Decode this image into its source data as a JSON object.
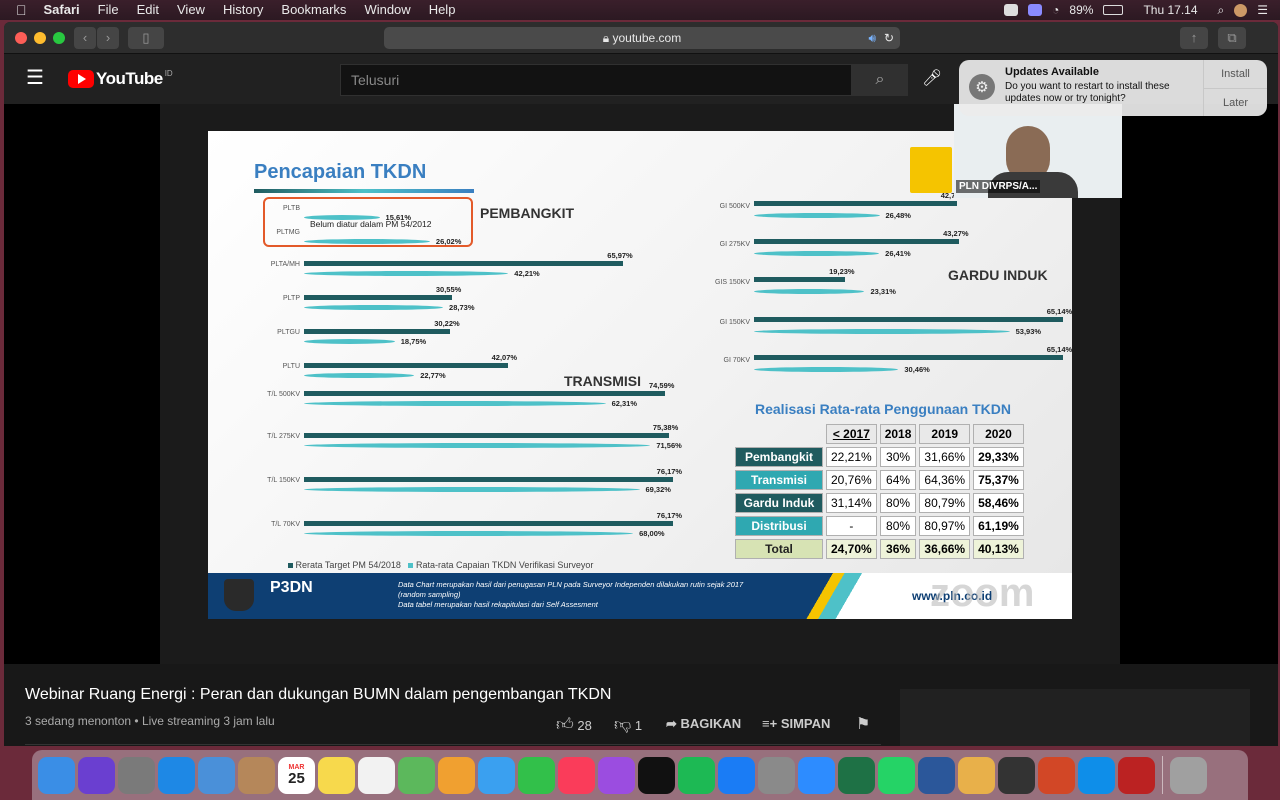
{
  "menubar": {
    "apple": "",
    "app": "Safari",
    "items": [
      "File",
      "Edit",
      "View",
      "History",
      "Bookmarks",
      "Window",
      "Help"
    ],
    "battery": "89%",
    "clock": "Thu 17.14"
  },
  "safari": {
    "url": "youtube.com"
  },
  "youtube": {
    "logo_text": "YouTube",
    "region": "ID",
    "search_placeholder": "Telusuri"
  },
  "notification": {
    "title": "Updates Available",
    "body": "Do you want to restart to install these updates now or try tonight?",
    "install": "Install",
    "later": "Later"
  },
  "webcam": {
    "name": "PLN DIVRPS/A..."
  },
  "slide": {
    "title": "Pencapaian TKDN",
    "pembangkit_label": "PEMBANGKIT",
    "transmisi_label": "TRANSMISI",
    "gardu_label": "GARDU INDUK",
    "note_box": "Belum diatur dalam PM 54/2012",
    "legend_dark": "Rerata Target PM 54/2018",
    "legend_light": "Rata-rata Capaian TKDN Verifikasi Surveyor",
    "footer_line1": "Data Chart merupakan hasil dari penugasan PLN pada Surveyor Independen dilakukan rutin sejak 2017",
    "footer_line2": "(random sampling)",
    "footer_line3": "Data tabel merupakan hasil rekapitulasi dari Self Assesment",
    "footer_logo": "P3DN",
    "website": "www.pln.co.id",
    "zoom": "zoom",
    "table_title": "Realisasi Rata-rata Penggunaan TKDN"
  },
  "chart_data": [
    {
      "type": "bar",
      "title": "Pencapaian TKDN",
      "categories": [
        "PLTB",
        "PLTMG",
        "PLTA/MH",
        "PLTP",
        "PLTGU",
        "PLTU",
        "T/L 500KV",
        "T/L 275KV",
        "T/L 150KV",
        "T/L 70KV"
      ],
      "series": [
        {
          "name": "Rerata Target PM 54/2018",
          "values": [
            null,
            null,
            65.97,
            30.55,
            30.22,
            42.07,
            74.59,
            75.38,
            76.17,
            76.17
          ]
        },
        {
          "name": "Rata-rata Capaian TKDN Verifikasi Surveyor",
          "values": [
            15.61,
            26.02,
            42.21,
            28.73,
            18.75,
            22.77,
            62.31,
            71.56,
            69.32,
            68.0
          ]
        }
      ],
      "value_labels_dark": [
        "",
        "",
        "65,97%",
        "30,55%",
        "30,22%",
        "42,07%",
        "74,59%",
        "75,38%",
        "76,17%",
        "76,17%"
      ],
      "value_labels_light": [
        "15,61%",
        "26,02%",
        "42,21%",
        "28,73%",
        "18,75%",
        "22,77%",
        "62,31%",
        "71,56%",
        "69,32%",
        "68,00%"
      ],
      "xlim": [
        0,
        100
      ]
    },
    {
      "type": "bar",
      "categories": [
        "GI 500KV",
        "GI 275KV",
        "GIS 150KV",
        "GI 150KV",
        "GI 70KV"
      ],
      "series": [
        {
          "name": "Rerata Target PM 54/2018",
          "values": [
            42.77,
            43.27,
            19.23,
            65.14,
            65.14
          ]
        },
        {
          "name": "Rata-rata Capaian TKDN Verifikasi Surveyor",
          "values": [
            26.48,
            26.41,
            23.31,
            53.93,
            30.46
          ]
        }
      ],
      "value_labels_dark": [
        "42,77%",
        "43,27%",
        "19,23%",
        "65,14%",
        "65,14%"
      ],
      "value_labels_light": [
        "26,48%",
        "26,41%",
        "23,31%",
        "53,93%",
        "30,46%"
      ],
      "xlim": [
        0,
        100
      ]
    },
    {
      "type": "table",
      "title": "Realisasi Rata-rata Penggunaan TKDN",
      "columns": [
        "< 2017",
        "2018",
        "2019",
        "2020"
      ],
      "rows": [
        {
          "label": "Pembangkit",
          "values": [
            "22,21%",
            "30%",
            "31,66%",
            "29,33%"
          ]
        },
        {
          "label": "Transmisi",
          "values": [
            "20,76%",
            "64%",
            "64,36%",
            "75,37%"
          ]
        },
        {
          "label": "Gardu Induk",
          "values": [
            "31,14%",
            "80%",
            "80,79%",
            "58,46%"
          ]
        },
        {
          "label": "Distribusi",
          "values": [
            "-",
            "80%",
            "80,97%",
            "61,19%"
          ]
        },
        {
          "label": "Total",
          "values": [
            "24,70%",
            "36%",
            "36,66%",
            "40,13%"
          ]
        }
      ]
    }
  ],
  "video": {
    "title": "Webinar Ruang Energi : Peran dan dukungan BUMN dalam pengembangan TKDN",
    "meta": "3 sedang menonton • Live streaming 3 jam lalu",
    "likes": "28",
    "dislikes": "1",
    "share": "BAGIKAN",
    "save": "SIMPAN"
  },
  "dock": {
    "calendar_month": "MAR",
    "calendar_day": "25",
    "apps": [
      "Finder",
      "Siri",
      "Launchpad",
      "Safari",
      "Preview",
      "Contacts",
      "Calendar",
      "Notes",
      "Reminders",
      "Maps",
      "Photos",
      "Messages",
      "FaceTime",
      "Music",
      "Podcasts",
      "TV",
      "Spotify",
      "App Store",
      "System Preferences",
      "Zoom",
      "Excel",
      "WhatsApp",
      "Word",
      "Pencil",
      "Stickies",
      "PowerPoint",
      "TeamViewer",
      "Stats",
      "Trash"
    ]
  },
  "colors": {
    "bar_dark": "#1f5b5f",
    "bar_light": "#4ec1c8",
    "title_blue": "#3a7fc1"
  }
}
